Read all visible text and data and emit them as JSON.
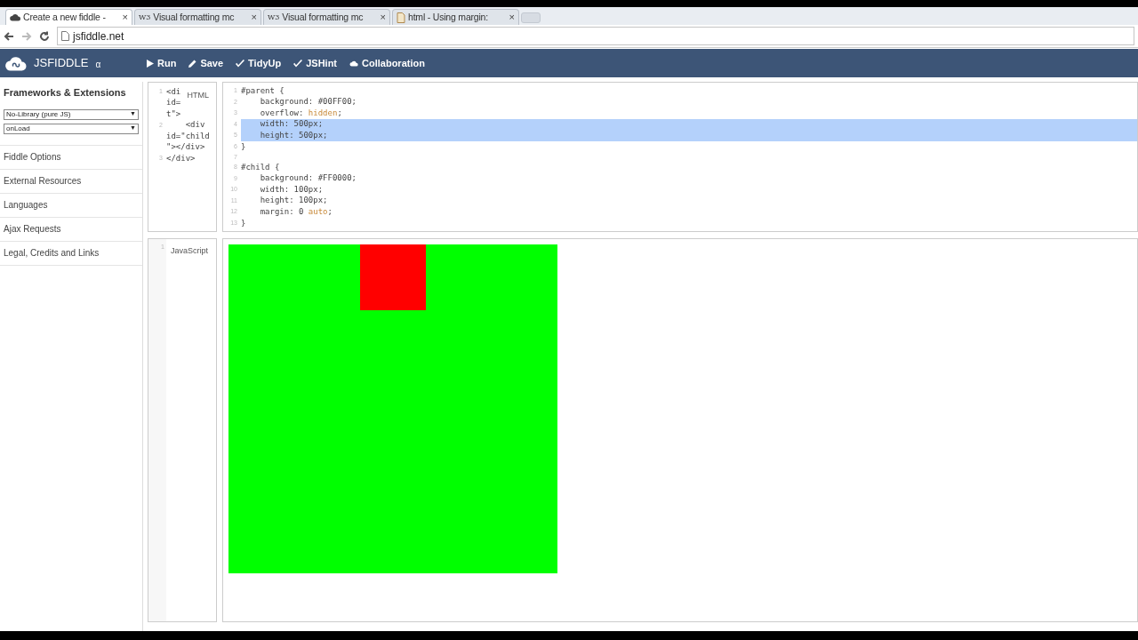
{
  "browser": {
    "tabs": [
      {
        "title": "Create a new fiddle -",
        "selected": true,
        "kind": "app"
      },
      {
        "title": "Visual formatting mc",
        "selected": false,
        "kind": "site",
        "icon_text": "W3"
      },
      {
        "title": "Visual formatting mc",
        "selected": false,
        "kind": "site",
        "icon_text": "W3"
      },
      {
        "title": "html - Using margin:",
        "selected": false,
        "kind": "forum"
      }
    ],
    "close": "×",
    "address": "jsfiddle.net"
  },
  "app": {
    "logo": "JSFIDDLE",
    "version": "α",
    "actions": [
      {
        "label": "Run",
        "kind": "run"
      },
      {
        "label": "Save",
        "kind": "save"
      },
      {
        "label": "TidyUp",
        "kind": "tidy"
      },
      {
        "label": "JSHint",
        "kind": "lint"
      },
      {
        "label": "Collaboration",
        "kind": "share"
      }
    ]
  },
  "sidebar": {
    "heading": "Frameworks & Extensions",
    "selects": [
      "No-Library (pure JS)",
      "onLoad"
    ],
    "arrow": "▼",
    "items": [
      "Fiddle Options",
      "External Resources",
      "Languages",
      "Ajax Requests",
      "Legal, Credits and Links"
    ]
  },
  "html_panel": {
    "label": "HTML",
    "rows": [
      {
        "number": "1",
        "text": "<di"
      },
      {
        "text": "id="
      },
      {
        "text": "t\">"
      },
      {
        "number": "2",
        "text": "    <div"
      },
      {
        "text": "id=\"child"
      },
      {
        "text": "\"></div>"
      },
      {
        "number": "3",
        "text": "</div>"
      }
    ]
  },
  "css_panel": {
    "lines": [
      {
        "number": "1",
        "highlighted": false,
        "parts": [
          {
            "t": "#parent {"
          }
        ]
      },
      {
        "number": "2",
        "highlighted": false,
        "parts": [
          {
            "t": "    background: #00FF00;"
          }
        ]
      },
      {
        "number": "3",
        "highlighted": false,
        "parts": [
          {
            "t": "    overflow: "
          },
          {
            "t": "hidden",
            "kind": "keyword"
          },
          {
            "t": ";"
          }
        ]
      },
      {
        "number": "4",
        "highlighted": true,
        "parts": [
          {
            "t": "    width: 500px;"
          }
        ]
      },
      {
        "number": "5",
        "highlighted": true,
        "parts": [
          {
            "t": "    height: 500px;"
          }
        ]
      },
      {
        "number": "6",
        "highlighted": false,
        "parts": [
          {
            "t": "}"
          }
        ]
      },
      {
        "number": "7",
        "highlighted": false
      },
      {
        "number": "8",
        "highlighted": false,
        "parts": [
          {
            "t": "#child {"
          }
        ]
      },
      {
        "number": "9",
        "highlighted": false,
        "parts": [
          {
            "t": "    background: #FF0000;"
          }
        ]
      },
      {
        "number": "10",
        "highlighted": false,
        "parts": [
          {
            "t": "    width: 100px;"
          }
        ]
      },
      {
        "number": "11",
        "highlighted": false,
        "parts": [
          {
            "t": "    height: 100px;"
          }
        ]
      },
      {
        "number": "12",
        "highlighted": false,
        "parts": [
          {
            "t": "    margin: 0 "
          },
          {
            "t": "auto",
            "kind": "keyword"
          },
          {
            "t": ";"
          }
        ]
      },
      {
        "number": "13",
        "highlighted": false,
        "parts": [
          {
            "t": "}"
          }
        ]
      }
    ]
  },
  "js_panel": {
    "label": "JavaScript",
    "line_number": "1"
  }
}
